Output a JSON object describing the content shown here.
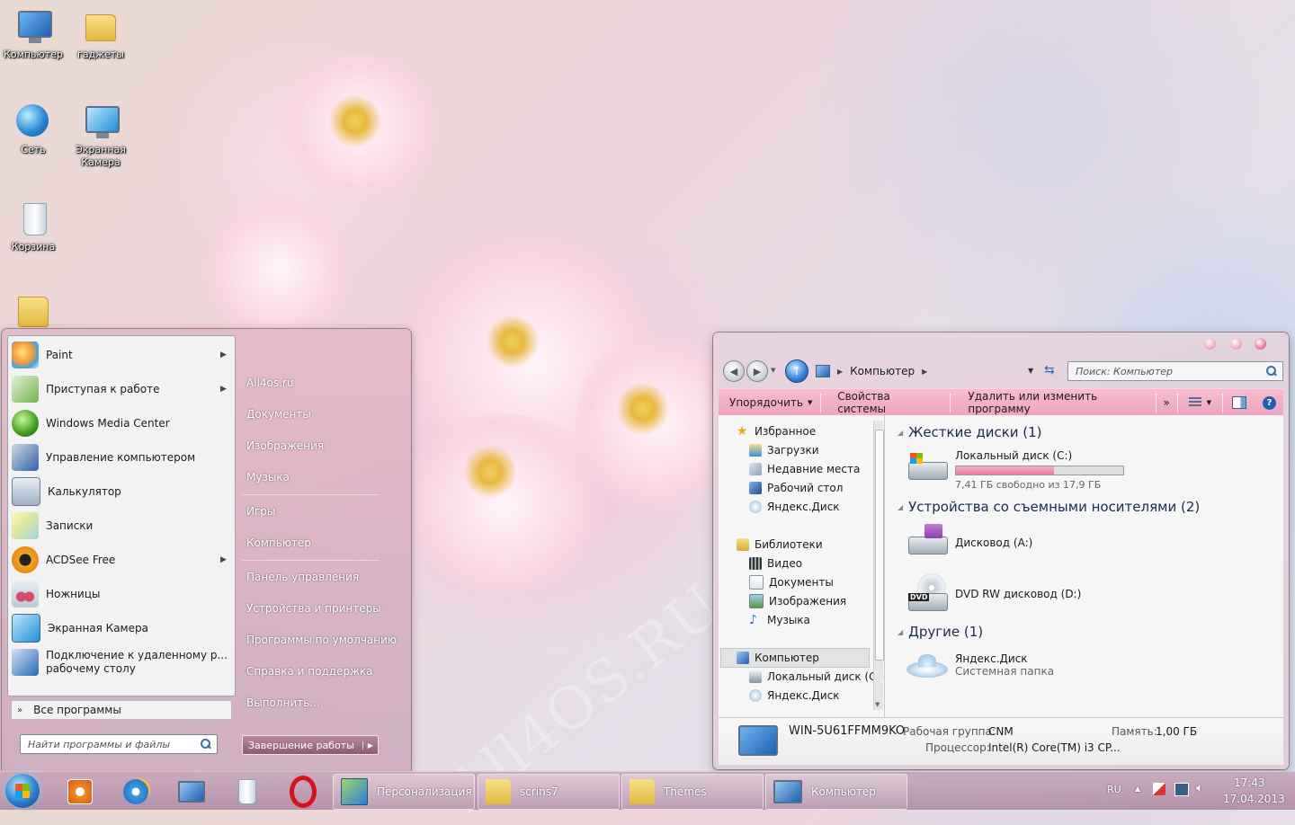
{
  "desktop": {
    "icons": [
      {
        "label": "Компьютер"
      },
      {
        "label": "гаджеты"
      },
      {
        "label": "Сеть"
      },
      {
        "label": "Экранная Камера"
      },
      {
        "label": "Корзина"
      }
    ],
    "watermark": "All4OS.RU"
  },
  "start_menu": {
    "programs": [
      {
        "label": "Paint",
        "has_submenu": true
      },
      {
        "label": "Приступая к работе",
        "has_submenu": true
      },
      {
        "label": "Windows Media Center",
        "has_submenu": false
      },
      {
        "label": "Управление компьютером",
        "has_submenu": false
      },
      {
        "label": "Калькулятор",
        "has_submenu": false
      },
      {
        "label": "Записки",
        "has_submenu": false
      },
      {
        "label": "ACDSee Free",
        "has_submenu": true
      },
      {
        "label": "Ножницы",
        "has_submenu": false
      },
      {
        "label": "Экранная Камера",
        "has_submenu": false
      },
      {
        "label": "Подключение к удаленному р... рабочему столу",
        "has_submenu": false
      }
    ],
    "all_programs": "Все программы",
    "search_placeholder": "Найти программы и файлы",
    "places": [
      {
        "label": "All4os.ru"
      },
      {
        "label": "Документы"
      },
      {
        "label": "Изображения"
      },
      {
        "label": "Музыка"
      },
      {
        "label": "Игры"
      },
      {
        "label": "Компьютер"
      },
      {
        "label": "Панель управления"
      },
      {
        "label": "Устройства и принтеры"
      },
      {
        "label": "Программы по умолчанию"
      },
      {
        "label": "Справка и поддержка"
      },
      {
        "label": "Выполнить..."
      }
    ],
    "shutdown": "Завершение работы"
  },
  "explorer": {
    "address": "Компьютер",
    "search_placeholder": "Поиск: Компьютер",
    "toolbar": {
      "organize": "Упорядочить",
      "system_properties": "Свойства системы",
      "uninstall": "Удалить или изменить программу",
      "more": "»"
    },
    "nav": {
      "favorites": "Избранное",
      "favorites_items": [
        "Загрузки",
        "Недавние места",
        "Рабочий стол",
        "Яндекс.Диск"
      ],
      "libraries": "Библиотеки",
      "libraries_items": [
        "Видео",
        "Документы",
        "Изображения",
        "Музыка"
      ],
      "computer": "Компьютер",
      "computer_items": [
        "Локальный диск (C:)",
        "Яндекс.Диск"
      ]
    },
    "groups": {
      "hard_drives": "Жесткие диски (1)",
      "removable": "Устройства со съемными носителями (2)",
      "other": "Другие (1)"
    },
    "local_disk": {
      "name": "Локальный диск (C:)",
      "free_text": "7,41 ГБ свободно из 17,9 ГБ",
      "used_fraction": 0.586
    },
    "floppy": "Дисковод (A:)",
    "dvd": "DVD RW дисковод (D:)",
    "dvd_badge": "DVD",
    "yandex": {
      "name": "Яндекс.Диск",
      "type": "Системная папка"
    },
    "details": {
      "computer_name": "WIN-5U61FFMM9KO",
      "workgroup_label": "Рабочая группа:",
      "workgroup": "CNM",
      "memory_label": "Память:",
      "memory": "1,00 ГБ",
      "cpu_label": "Процессор:",
      "cpu": "Intel(R) Core(TM) i3 CP..."
    }
  },
  "taskbar": {
    "tasks": [
      {
        "label": "Персонализация"
      },
      {
        "label": "scrins7"
      },
      {
        "label": "Themes"
      },
      {
        "label": "Компьютер"
      }
    ],
    "lang": "RU",
    "time": "17:43",
    "date": "17.04.2013"
  },
  "colors": {
    "accent_pink": "#f0a8c0",
    "disk_fill": "#e87f9f"
  }
}
